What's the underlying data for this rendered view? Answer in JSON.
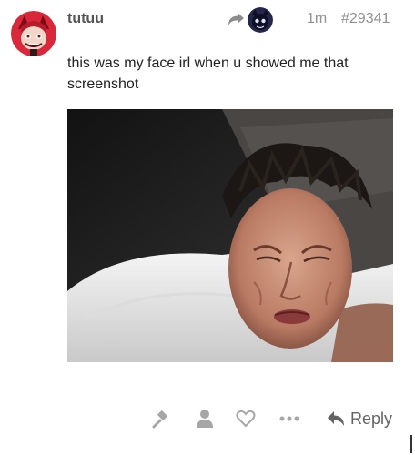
{
  "post": {
    "username": "tutuu",
    "age": "1m",
    "post_number": "#29341",
    "body": "this was my face irl when u showed me that screenshot"
  },
  "icons": {
    "avatar": "avatar-icon",
    "reply_to": "reply-arrow-icon",
    "flag": "flag-icon",
    "user": "user-icon",
    "like": "heart-icon",
    "more": "ellipsis-icon",
    "reply": "reply-icon"
  },
  "actions": {
    "reply_label": "Reply"
  },
  "colors": {
    "muted": "#919191",
    "icon": "#a6a6a6",
    "avatar_red": "#d8283a"
  }
}
